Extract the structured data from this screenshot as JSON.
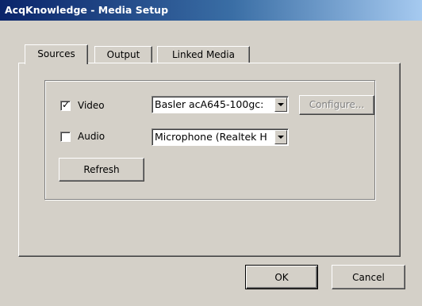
{
  "window": {
    "title": "AcqKnowledge - Media Setup"
  },
  "tabs": [
    {
      "label": "Sources",
      "active": true
    },
    {
      "label": "Output",
      "active": false
    },
    {
      "label": "Linked Media",
      "active": false
    }
  ],
  "sources": {
    "video": {
      "label": "Video",
      "checked": true,
      "device": "Basler acA645-100gc:",
      "configure_label": "Configure..."
    },
    "audio": {
      "label": "Audio",
      "checked": false,
      "device": "Microphone (Realtek H"
    },
    "refresh_label": "Refresh"
  },
  "footer": {
    "ok_label": "OK",
    "cancel_label": "Cancel"
  },
  "icons": {
    "check": "checkmark-icon",
    "dropdown": "chevron-down-icon"
  }
}
